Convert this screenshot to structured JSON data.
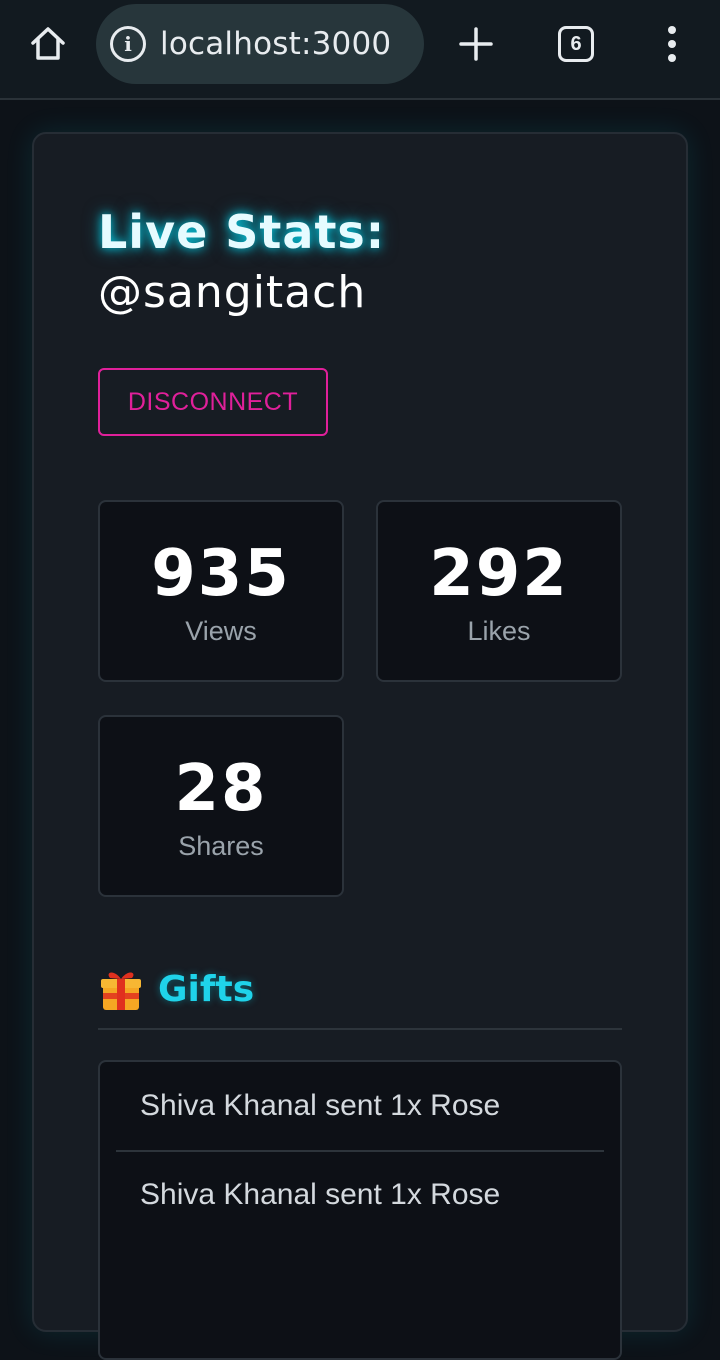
{
  "browser": {
    "url": "localhost:3000",
    "tab_count": "6"
  },
  "header": {
    "title": "Live Stats:",
    "handle": "@sangitach",
    "disconnect_label": "DISCONNECT"
  },
  "stats": [
    {
      "value": "935",
      "label": "Views"
    },
    {
      "value": "292",
      "label": "Likes"
    },
    {
      "value": "28",
      "label": "Shares"
    }
  ],
  "gifts": {
    "title": "Gifts",
    "icon": "gift-icon",
    "items": [
      "Shiva Khanal sent 1x Rose",
      "Shiva Khanal sent 1x Rose"
    ]
  },
  "colors": {
    "accent_cyan": "#1fd3ea",
    "disconnect_magenta": "#e0209a",
    "card_bg": "#171c23"
  }
}
